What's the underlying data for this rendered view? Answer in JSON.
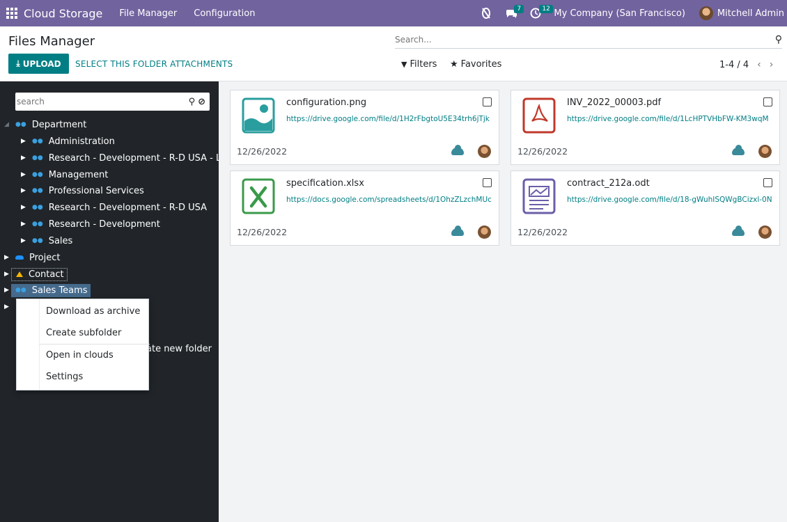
{
  "navbar": {
    "app_name": "Cloud Storage",
    "menus": [
      "File Manager",
      "Configuration"
    ],
    "messages_count": "7",
    "activities_count": "12",
    "company": "My Company (San Francisco)",
    "user": "Mitchell Admin",
    "accent": "#71639e"
  },
  "control": {
    "title": "Files Manager",
    "upload_label": "UPLOAD",
    "attach_label": "SELECT THIS FOLDER ATTACHMENTS",
    "search_placeholder": "Search...",
    "filters_label": "Filters",
    "favorites_label": "Favorites",
    "pager": "1-4 / 4"
  },
  "sidebar": {
    "search_placeholder": "search",
    "tree": {
      "department": "Department",
      "children": [
        "Administration",
        "Research - Development - R-D USA - Long",
        "Management",
        "Professional Services",
        "Research - Development - R-D USA",
        "Research - Development",
        "Sales"
      ],
      "project": "Project",
      "contact": "Contact",
      "sales_teams": "Sales Teams"
    },
    "create_new_folder": "ate new folder"
  },
  "context_menu": {
    "items": [
      "Download as archive",
      "Create subfolder",
      "Open in clouds",
      "Settings"
    ]
  },
  "files": [
    {
      "name": "configuration.png",
      "url": "https://drive.google.com/file/d/1H2rFbgtoU5E34trh6jTjk",
      "date": "12/26/2022",
      "type": "image"
    },
    {
      "name": "INV_2022_00003.pdf",
      "url": "https://drive.google.com/file/d/1LcHPTVHbFW-KM3wqM",
      "date": "12/26/2022",
      "type": "pdf"
    },
    {
      "name": "specification.xlsx",
      "url": "https://docs.google.com/spreadsheets/d/1OhzZLzchMUc",
      "date": "12/26/2022",
      "type": "spreadsheet"
    },
    {
      "name": "contract_212a.odt",
      "url": "https://drive.google.com/file/d/18-gWuhISQWgBCizxl-0N",
      "date": "12/26/2022",
      "type": "document"
    }
  ]
}
